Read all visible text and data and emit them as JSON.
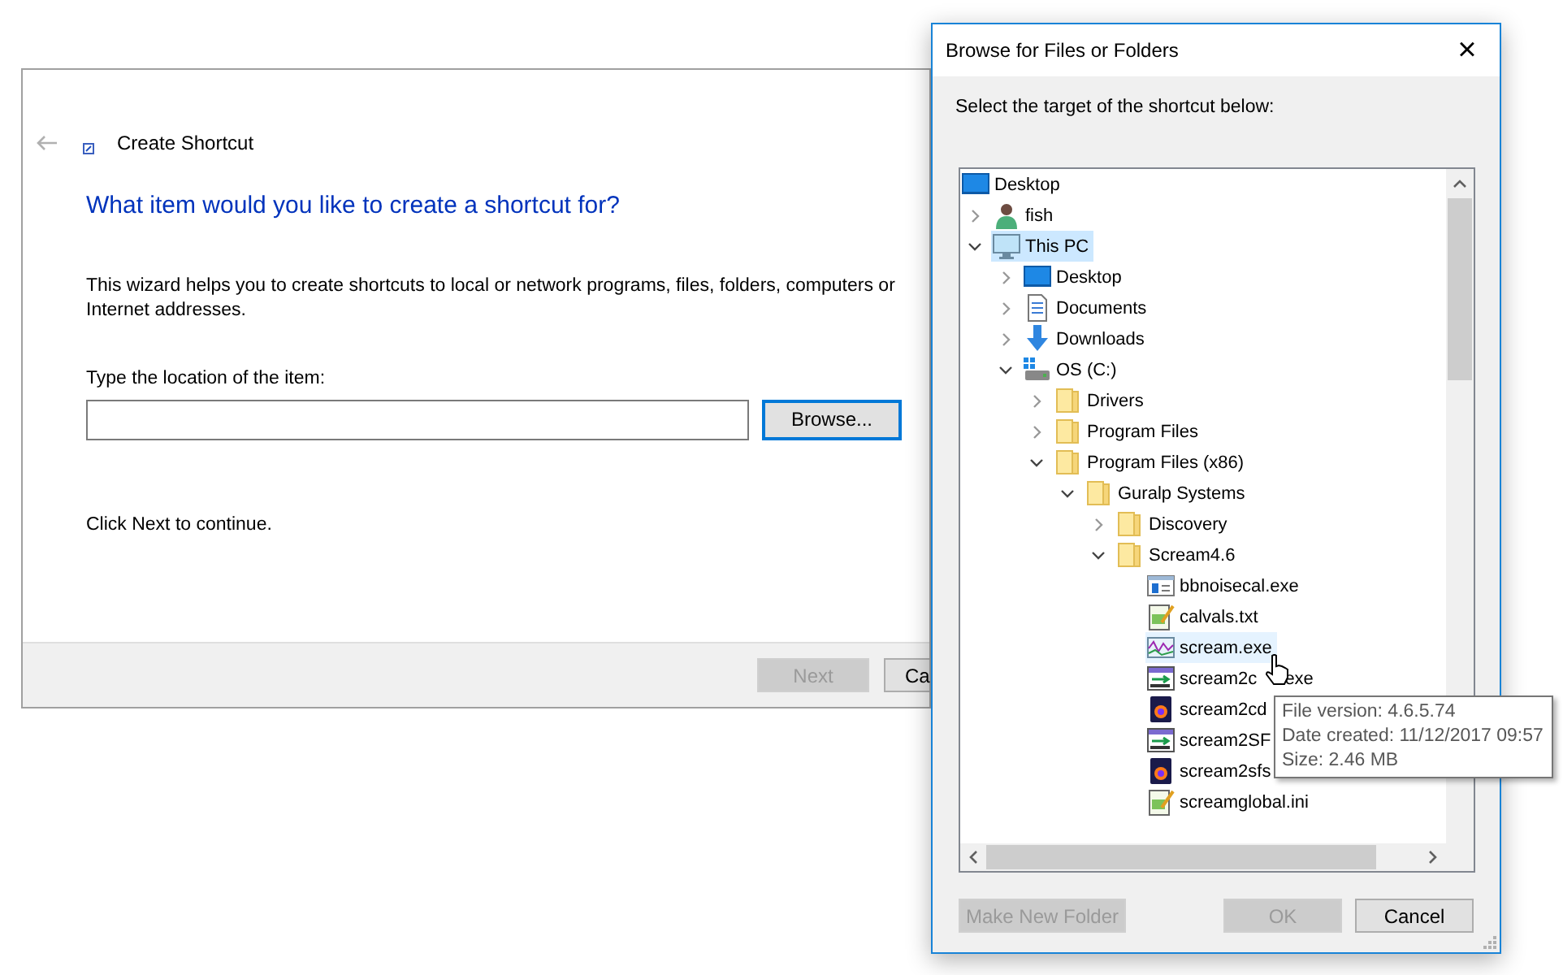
{
  "wizard": {
    "title": "Create Shortcut",
    "heading": "What item would you like to create a shortcut for?",
    "description": "This wizard helps you to create shortcuts to local or network programs, files, folders, computers or Internet addresses.",
    "location_label": "Type the location of the item:",
    "browse_button": "Browse...",
    "hint": "Click Next to continue.",
    "buttons": [
      {
        "label": "Next",
        "disabled": true
      },
      {
        "label": "Ca",
        "disabled": false
      }
    ]
  },
  "dialog": {
    "title": "Browse for Files or Folders",
    "close": "×",
    "instruction": "Select the target of the shortcut below:",
    "tree": [
      {
        "label": "Desktop",
        "kind": "desktop",
        "selected": false,
        "children": [
          {
            "label": "fish",
            "kind": "user",
            "expanded": false,
            "selected": false
          },
          {
            "label": "This PC",
            "kind": "pc",
            "expanded": true,
            "selected": true,
            "children": [
              {
                "label": "Desktop",
                "kind": "desktop",
                "expanded": false,
                "selected": false
              },
              {
                "label": "Documents",
                "kind": "documents",
                "expanded": false,
                "selected": false
              },
              {
                "label": "Downloads",
                "kind": "downloads",
                "expanded": false,
                "selected": false
              },
              {
                "label": "OS (C:)",
                "kind": "drive",
                "expanded": true,
                "selected": false,
                "children": [
                  {
                    "label": "Drivers",
                    "kind": "folder",
                    "expanded": false,
                    "selected": false
                  },
                  {
                    "label": "Program Files",
                    "kind": "folder",
                    "expanded": false,
                    "selected": false
                  },
                  {
                    "label": "Program Files (x86)",
                    "kind": "folder",
                    "expanded": true,
                    "selected": false,
                    "children": [
                      {
                        "label": "Guralp Systems",
                        "kind": "folder",
                        "expanded": true,
                        "selected": false,
                        "children": [
                          {
                            "label": "Discovery",
                            "kind": "folder",
                            "expanded": false,
                            "selected": false
                          },
                          {
                            "label": "Scream4.6",
                            "kind": "folder",
                            "expanded": true,
                            "selected": false,
                            "children": [
                              {
                                "label": "bbnoisecal.exe",
                                "kind": "window-app",
                                "selected": false,
                                "hovered": false
                              },
                              {
                                "label": "calvals.txt",
                                "kind": "text-file",
                                "selected": false,
                                "hovered": false
                              },
                              {
                                "label": "scream.exe",
                                "kind": "chart-app",
                                "selected": false,
                                "hovered": true
                              },
                              {
                                "label": "scream2c",
                                "label_end": "exe",
                                "kind": "convert-app",
                                "selected": false,
                                "hovered": false
                              },
                              {
                                "label": "scream2cd",
                                "kind": "media-file",
                                "selected": false,
                                "hovered": false
                              },
                              {
                                "label": "scream2SF",
                                "kind": "convert-app",
                                "selected": false,
                                "hovered": false
                              },
                              {
                                "label": "scream2sfs",
                                "kind": "media-file",
                                "selected": false,
                                "hovered": false
                              },
                              {
                                "label": "screamglobal.ini",
                                "kind": "text-file",
                                "selected": false,
                                "hovered": false
                              }
                            ]
                          }
                        ]
                      }
                    ]
                  }
                ]
              }
            ]
          }
        ]
      }
    ],
    "tooltip": [
      "File version: 4.6.5.74",
      "Date created: 11/12/2017 09:57",
      "Size: 2.46 MB"
    ],
    "buttons": [
      {
        "label": "Make New Folder",
        "disabled": true
      },
      {
        "label": "OK",
        "disabled": true
      },
      {
        "label": "Cancel",
        "disabled": false
      }
    ]
  }
}
